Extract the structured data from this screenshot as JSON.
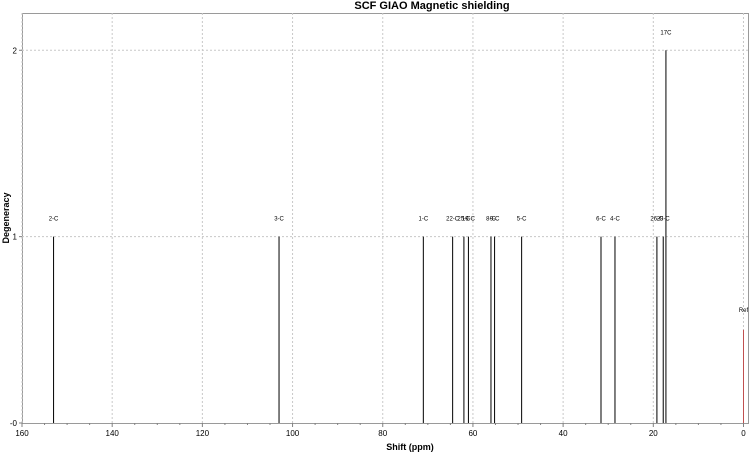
{
  "chart_data": {
    "type": "bar",
    "title": "SCF GIAO Magnetic shielding",
    "xlabel": "Shift (ppm)",
    "ylabel": "Degeneracy",
    "xlim": [
      160,
      -1
    ],
    "ylim": [
      0,
      2.2
    ],
    "x_reversed": true,
    "grid": true,
    "x_ticks": [
      160,
      140,
      120,
      100,
      80,
      60,
      40,
      20,
      0
    ],
    "y_ticks": [
      0,
      1,
      2
    ],
    "y_tick_labels": [
      "-0",
      "1",
      "2"
    ],
    "peaks": [
      {
        "label": "2-C",
        "x": 153.0,
        "y": 1
      },
      {
        "label": "3-C",
        "x": 103.0,
        "y": 1
      },
      {
        "label": "1-C",
        "x": 71.0,
        "y": 1
      },
      {
        "label": "22-C",
        "x": 64.5,
        "y": 1
      },
      {
        "label": "25-C",
        "x": 62.0,
        "y": 1
      },
      {
        "label": "19-C",
        "x": 61.0,
        "y": 1
      },
      {
        "label": "8-C",
        "x": 56.0,
        "y": 1
      },
      {
        "label": "9-C",
        "x": 55.2,
        "y": 1
      },
      {
        "label": "5-C",
        "x": 49.2,
        "y": 1
      },
      {
        "label": "6-C",
        "x": 31.6,
        "y": 1
      },
      {
        "label": "4-C",
        "x": 28.5,
        "y": 1
      },
      {
        "label": "26-C",
        "x": 19.2,
        "y": 1
      },
      {
        "label": "29-C",
        "x": 17.8,
        "y": 1
      },
      {
        "label": "17C",
        "x": 17.2,
        "y": 2
      }
    ],
    "reference": {
      "label": "Ref",
      "x": 0.0,
      "y": 0.5,
      "color": "#c05050"
    },
    "colors": {
      "peak": "#000000",
      "grid": "#c8c8c8",
      "axis": "#808080"
    }
  }
}
